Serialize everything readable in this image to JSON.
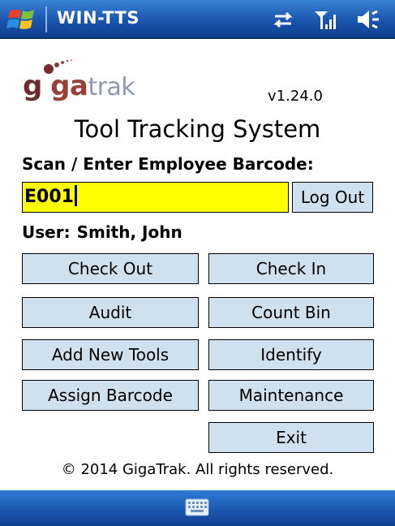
{
  "titlebar": {
    "app_title": "WIN-TTS",
    "icons": [
      "windows-start-icon",
      "sync-icon",
      "signal-icon",
      "volume-icon"
    ]
  },
  "logo": {
    "part1": "g",
    "part2": "ga",
    "part3": "trak"
  },
  "version": "v1.24.0",
  "title": "Tool Tracking System",
  "prompt": "Scan / Enter Employee Barcode:",
  "barcode_input": {
    "value": "E001"
  },
  "logout_label": "Log Out",
  "user": {
    "label": "User:",
    "name": "Smith, John"
  },
  "buttons": {
    "check_out": "Check Out",
    "check_in": "Check In",
    "audit": "Audit",
    "count_bin": "Count Bin",
    "add_new_tools": "Add New Tools",
    "identify": "Identify",
    "assign_barcode": "Assign Barcode",
    "maintenance": "Maintenance",
    "exit": "Exit"
  },
  "copyright": "© 2014 GigaTrak.  All rights reserved.",
  "bottombar": {
    "icon": "keyboard-icon"
  },
  "colors": {
    "titlebar": "#1a55ad",
    "button_bg": "#cfe0ee",
    "input_bg": "#ffff00"
  }
}
